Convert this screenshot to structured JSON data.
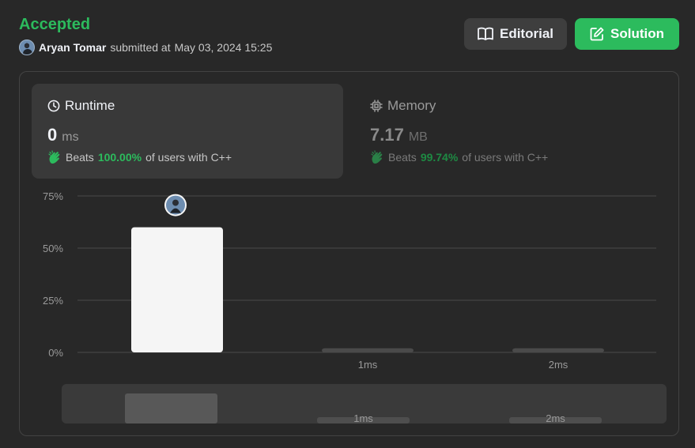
{
  "status": "Accepted",
  "submission": {
    "user": "Aryan Tomar",
    "submitted_text": "submitted at",
    "timestamp": "May 03, 2024 15:25"
  },
  "buttons": {
    "editorial": "Editorial",
    "solution": "Solution"
  },
  "runtime": {
    "label": "Runtime",
    "value": "0",
    "unit": "ms",
    "beats_prefix": "Beats",
    "beats_pct": "100.00%",
    "beats_suffix": "of users with C++"
  },
  "memory": {
    "label": "Memory",
    "value": "7.17",
    "unit": "MB",
    "beats_prefix": "Beats",
    "beats_pct": "99.74%",
    "beats_suffix": "of users with C++"
  },
  "colors": {
    "accent": "#2cbb5d",
    "background": "#282828",
    "card": "#393939"
  },
  "chart_data": {
    "type": "bar",
    "categories": [
      "",
      "1ms",
      "2ms"
    ],
    "values": [
      60,
      2,
      2
    ],
    "yticks": [
      "75%",
      "50%",
      "25%",
      "0%"
    ],
    "ylim": [
      0,
      75
    ],
    "highlight_index": 0,
    "grid": true,
    "minimap_labels": [
      "1ms",
      "2ms"
    ]
  }
}
